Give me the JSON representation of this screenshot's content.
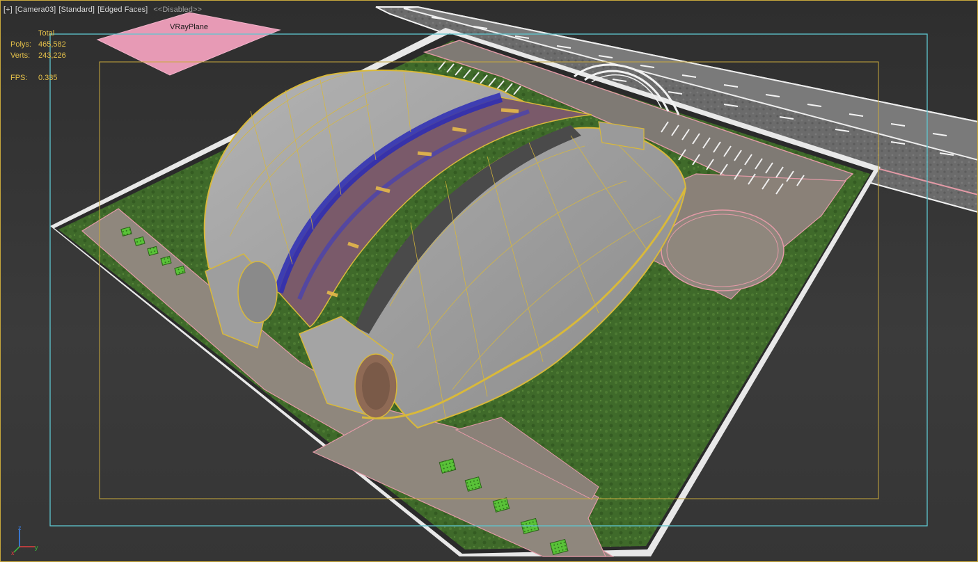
{
  "viewport": {
    "menu_label": "[+]",
    "camera_label": "[Camera03]",
    "shading_label": "[Standard]",
    "edged_faces_label": "[Edged Faces]",
    "disabled_label": "<<Disabled>>"
  },
  "stats": {
    "header": "Total",
    "polys_label": "Polys:",
    "polys_value": "465,582",
    "verts_label": "Verts:",
    "verts_value": "243,226",
    "fps_label": "FPS:",
    "fps_value": "0.335"
  },
  "scene": {
    "plane_label": "VRayPlane",
    "axis_z": "z",
    "axis_x": "x",
    "axis_y": "y"
  },
  "colors": {
    "selection_yellow": "#d9b93a",
    "safe_frame_cyan": "#5ec7d0",
    "grass": "#3f6a2a",
    "pavement": "#8a8178",
    "road": "#6a6a6a",
    "shell": "#9b9b9b",
    "pink_outline": "#e49aa7",
    "vray_plane": "#e79ab5",
    "stats_text": "#e6c24a"
  }
}
